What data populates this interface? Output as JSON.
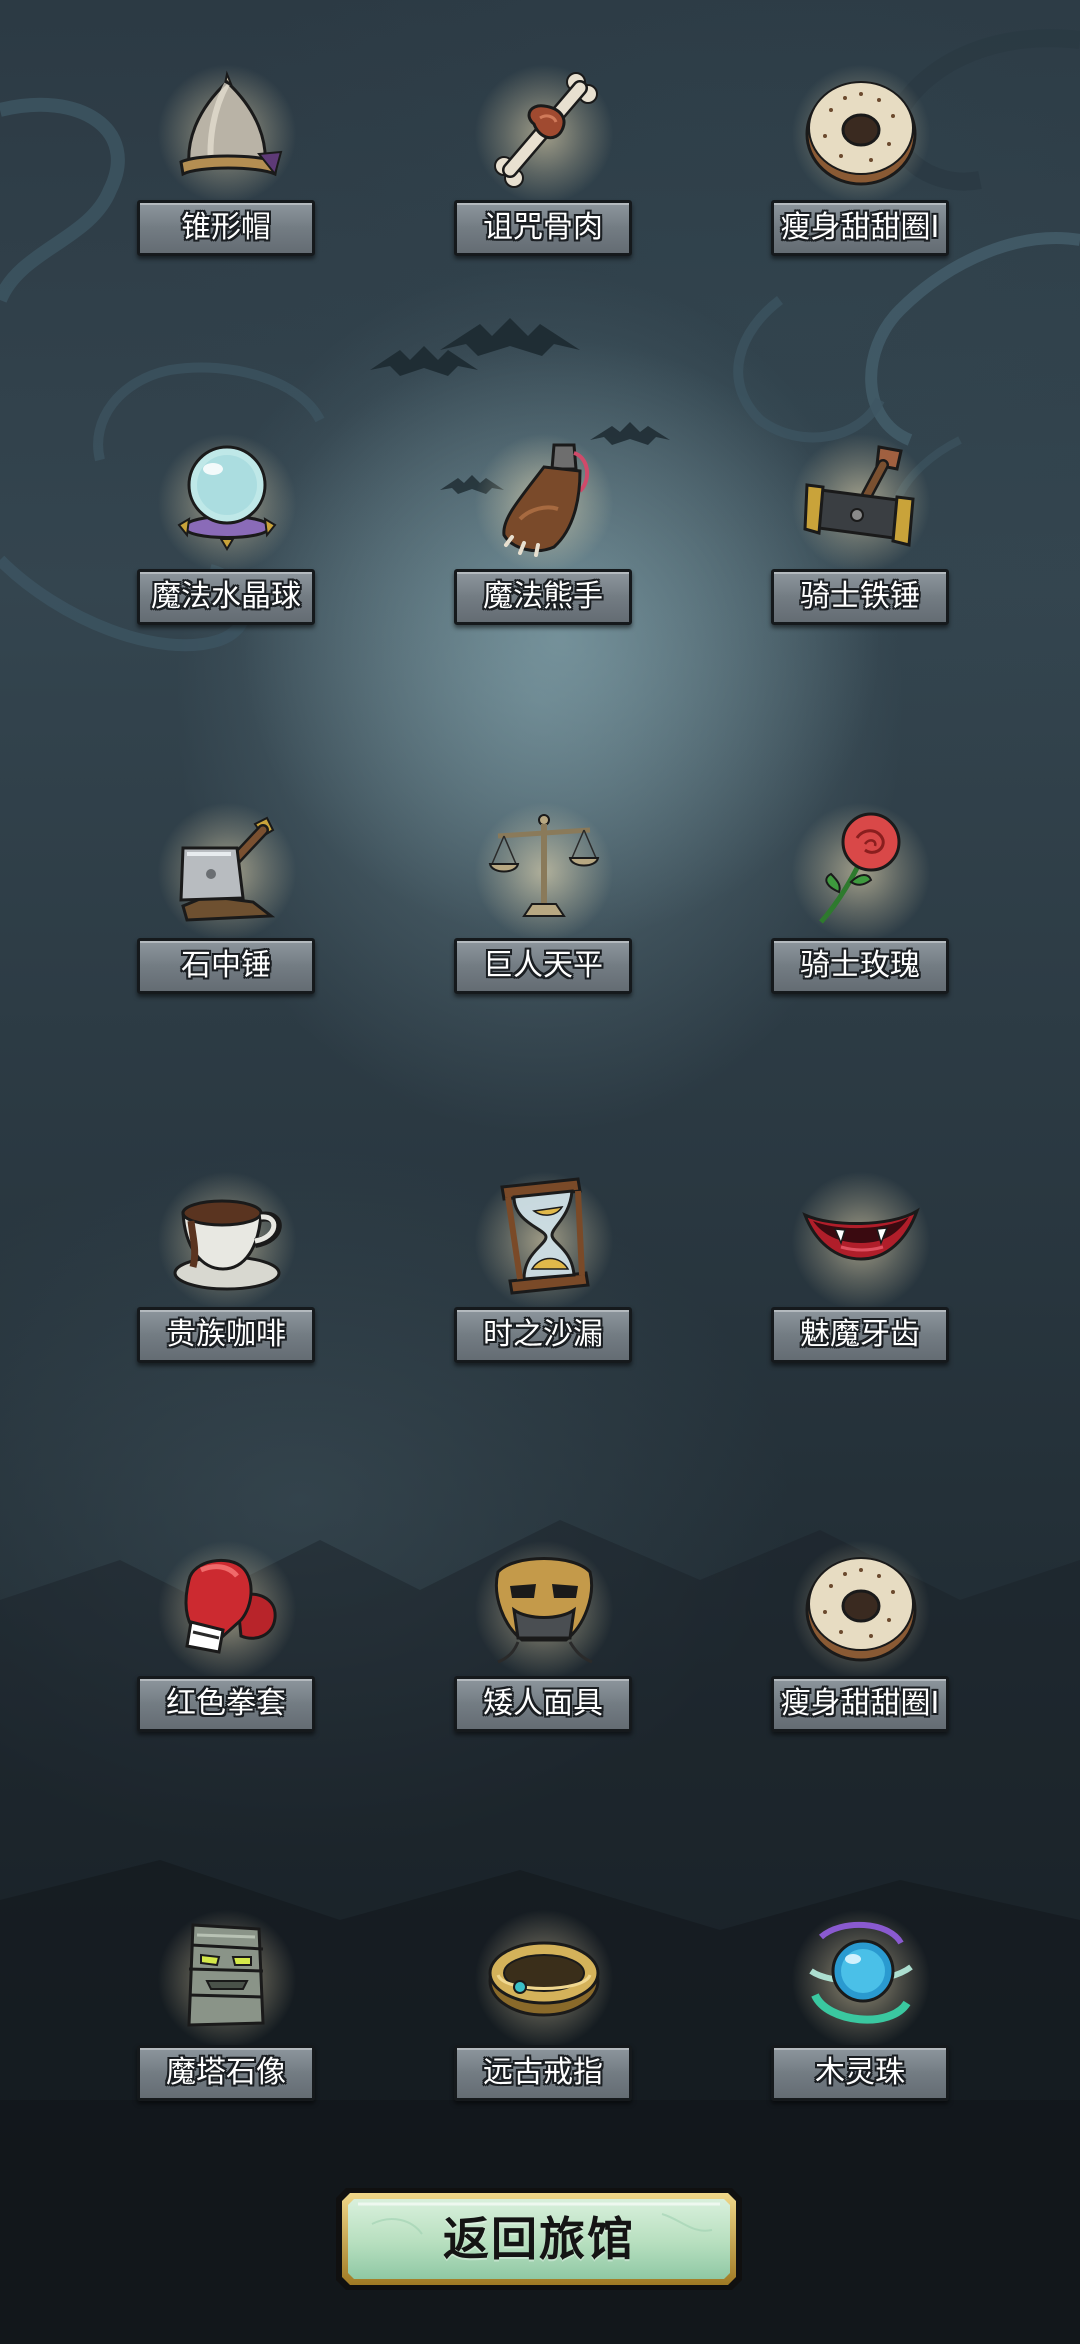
{
  "screen": {
    "name": "item-collection"
  },
  "items": [
    {
      "label": "锥形帽",
      "icon": "cone-helmet-icon"
    },
    {
      "label": "诅咒骨肉",
      "icon": "cursed-bone-meat-icon"
    },
    {
      "label": "瘦身甜甜圈I",
      "icon": "donut-icon"
    },
    {
      "label": "魔法水晶球",
      "icon": "crystal-ball-icon"
    },
    {
      "label": "魔法熊手",
      "icon": "bear-paw-icon"
    },
    {
      "label": "骑士铁锤",
      "icon": "knight-hammer-icon"
    },
    {
      "label": "石中锤",
      "icon": "hammer-in-stone-icon"
    },
    {
      "label": "巨人天平",
      "icon": "scales-icon"
    },
    {
      "label": "骑士玫瑰",
      "icon": "rose-icon"
    },
    {
      "label": "贵族咖啡",
      "icon": "coffee-cup-icon"
    },
    {
      "label": "时之沙漏",
      "icon": "hourglass-icon"
    },
    {
      "label": "魅魔牙齿",
      "icon": "fang-lips-icon"
    },
    {
      "label": "红色拳套",
      "icon": "boxing-glove-icon"
    },
    {
      "label": "矮人面具",
      "icon": "dwarf-mask-icon"
    },
    {
      "label": "瘦身甜甜圈I",
      "icon": "donut-icon"
    },
    {
      "label": "魔塔石像",
      "icon": "tower-statue-icon"
    },
    {
      "label": "远古戒指",
      "icon": "ancient-ring-icon"
    },
    {
      "label": "木灵珠",
      "icon": "wood-spirit-orb-icon"
    }
  ],
  "return_button": {
    "label": "返回旅馆"
  },
  "colors": {
    "label_bg": "#737c83",
    "label_border": "#15191c",
    "button_face": "#bfe0c0",
    "button_rim": "#c9a33a"
  }
}
